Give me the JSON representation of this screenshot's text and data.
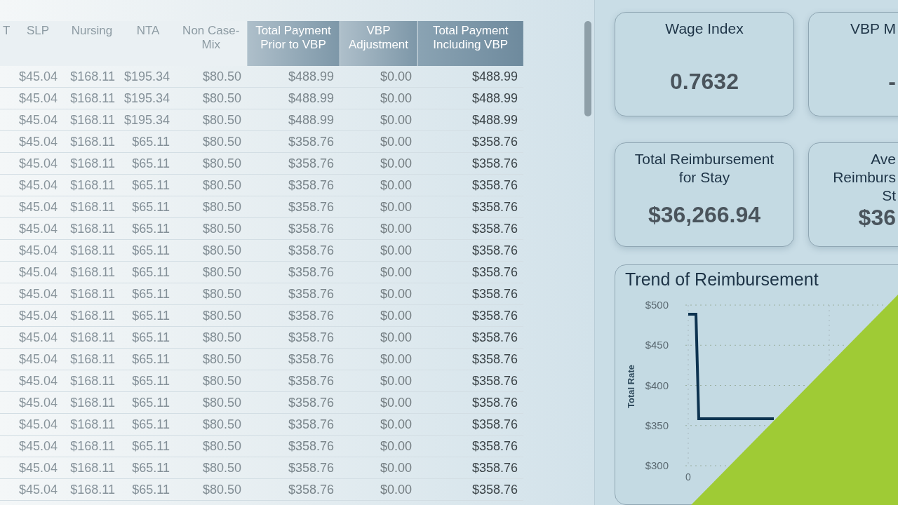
{
  "table": {
    "partial_column_header": "T",
    "columns": [
      "SLP",
      "Nursing",
      "NTA",
      "Non Case-Mix",
      "Total Payment Prior to VBP",
      "VBP Adjustment",
      "Total Payment Including VBP"
    ],
    "rows": [
      [
        "$45.04",
        "$168.11",
        "$195.34",
        "$80.50",
        "$488.99",
        "$0.00",
        "$488.99"
      ],
      [
        "$45.04",
        "$168.11",
        "$195.34",
        "$80.50",
        "$488.99",
        "$0.00",
        "$488.99"
      ],
      [
        "$45.04",
        "$168.11",
        "$195.34",
        "$80.50",
        "$488.99",
        "$0.00",
        "$488.99"
      ],
      [
        "$45.04",
        "$168.11",
        "$65.11",
        "$80.50",
        "$358.76",
        "$0.00",
        "$358.76"
      ],
      [
        "$45.04",
        "$168.11",
        "$65.11",
        "$80.50",
        "$358.76",
        "$0.00",
        "$358.76"
      ],
      [
        "$45.04",
        "$168.11",
        "$65.11",
        "$80.50",
        "$358.76",
        "$0.00",
        "$358.76"
      ],
      [
        "$45.04",
        "$168.11",
        "$65.11",
        "$80.50",
        "$358.76",
        "$0.00",
        "$358.76"
      ],
      [
        "$45.04",
        "$168.11",
        "$65.11",
        "$80.50",
        "$358.76",
        "$0.00",
        "$358.76"
      ],
      [
        "$45.04",
        "$168.11",
        "$65.11",
        "$80.50",
        "$358.76",
        "$0.00",
        "$358.76"
      ],
      [
        "$45.04",
        "$168.11",
        "$65.11",
        "$80.50",
        "$358.76",
        "$0.00",
        "$358.76"
      ],
      [
        "$45.04",
        "$168.11",
        "$65.11",
        "$80.50",
        "$358.76",
        "$0.00",
        "$358.76"
      ],
      [
        "$45.04",
        "$168.11",
        "$65.11",
        "$80.50",
        "$358.76",
        "$0.00",
        "$358.76"
      ],
      [
        "$45.04",
        "$168.11",
        "$65.11",
        "$80.50",
        "$358.76",
        "$0.00",
        "$358.76"
      ],
      [
        "$45.04",
        "$168.11",
        "$65.11",
        "$80.50",
        "$358.76",
        "$0.00",
        "$358.76"
      ],
      [
        "$45.04",
        "$168.11",
        "$65.11",
        "$80.50",
        "$358.76",
        "$0.00",
        "$358.76"
      ],
      [
        "$45.04",
        "$168.11",
        "$65.11",
        "$80.50",
        "$358.76",
        "$0.00",
        "$358.76"
      ],
      [
        "$45.04",
        "$168.11",
        "$65.11",
        "$80.50",
        "$358.76",
        "$0.00",
        "$358.76"
      ],
      [
        "$45.04",
        "$168.11",
        "$65.11",
        "$80.50",
        "$358.76",
        "$0.00",
        "$358.76"
      ],
      [
        "$45.04",
        "$168.11",
        "$65.11",
        "$80.50",
        "$358.76",
        "$0.00",
        "$358.76"
      ],
      [
        "$45.04",
        "$168.11",
        "$65.11",
        "$80.50",
        "$358.76",
        "$0.00",
        "$358.76"
      ]
    ]
  },
  "cards": [
    {
      "title_lines": [
        "Wage Index"
      ],
      "value": "0.7632"
    },
    {
      "title_lines": [
        "VBP M"
      ],
      "value": "-"
    },
    {
      "title_lines": [
        "Total Reimbursement",
        "for Stay"
      ],
      "value": "$36,266.94"
    },
    {
      "title_lines": [
        "Ave",
        "Reimburs",
        "St"
      ],
      "value": "$36"
    }
  ],
  "trend": {
    "title": "Trend of Reimbursement",
    "axis_title": "Total Rate",
    "y_tick_labels": [
      "$500",
      "$450",
      "$400",
      "$350",
      "$300"
    ],
    "x_tick_label": "0"
  }
}
